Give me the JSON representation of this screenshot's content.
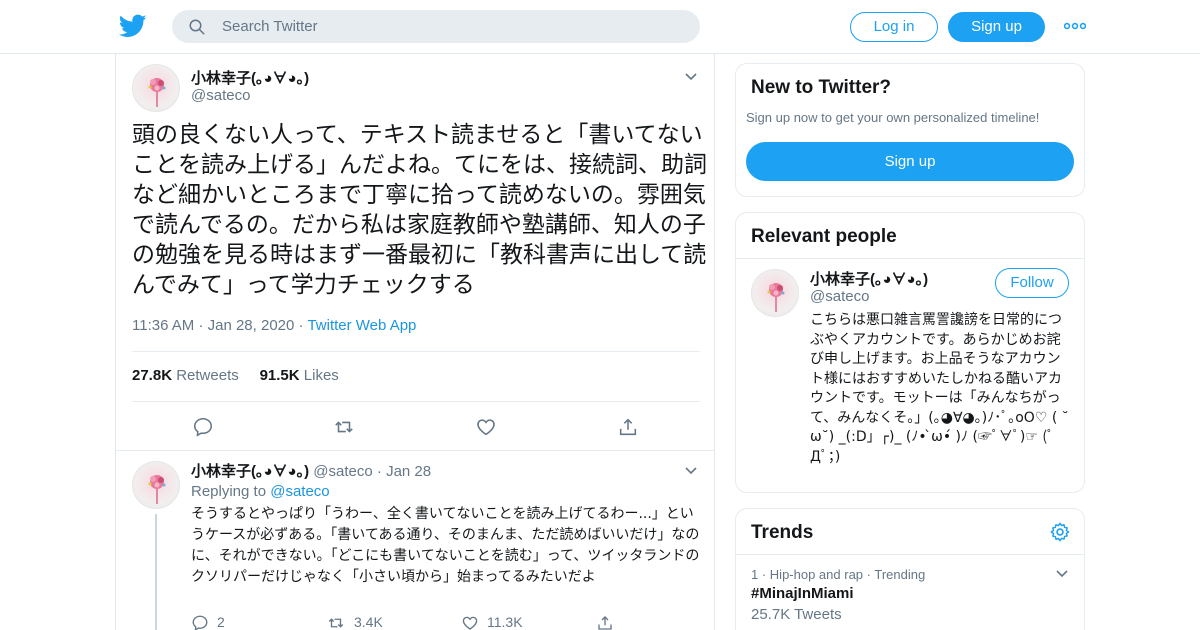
{
  "header": {
    "search_placeholder": "Search Twitter",
    "login_label": "Log in",
    "signup_label": "Sign up"
  },
  "tweet": {
    "author_name": "小林幸子(｡◕∀◕｡)",
    "author_handle": "@sateco",
    "text": "頭の良くない人って、テキスト読ませると「書いてないことを読み上げる」んだよね。てにをは、接続詞、助詞など細かいところまで丁寧に拾って読めないの。雰囲気で読んでるの。だから私は家庭教師や塾講師、知人の子の勉強を見る時はまず一番最初に「教科書声に出して読んでみて」って学力チェックする",
    "time": "11:36 AM",
    "date": "Jan 28, 2020",
    "source": "Twitter Web App",
    "retweets_count": "27.8K",
    "retweets_label": "Retweets",
    "likes_count": "91.5K",
    "likes_label": "Likes"
  },
  "reply": {
    "author_name": "小林幸子(｡◕∀◕｡)",
    "author_handle": "@sateco",
    "date": "Jan 28",
    "replying_label": "Replying to",
    "replying_to": "@sateco",
    "text": "そうするとやっぱり「うわー、全く書いてないことを読み上げてるわー...」というケースが必ずある。「書いてある通り、そのまんま、ただ読めばいいだけ」なのに、それができない。「どこにも書いてないことを読む」って、ツイッタランドのクソリパーだけじゃなく「小さい頃から」始まってるみたいだよ",
    "replies": "2",
    "retweets": "3.4K",
    "likes": "11.3K"
  },
  "sidebar": {
    "new_title": "New to Twitter?",
    "new_subtitle": "Sign up now to get your own personalized timeline!",
    "new_signup": "Sign up",
    "relevant_title": "Relevant people",
    "person_name": "小林幸子(｡◕∀◕｡)",
    "person_handle": "@sateco",
    "follow_label": "Follow",
    "person_bio": "こちらは悪口雑言罵詈讒謗を日常的につぶやくアカウントです。あらかじめお詫び申し上げます。お上品そうなアカウント様にはおすすめいたしかねる酷いアカウントです。モットーは「みんなちがって、みんなくそ。」(｡◕∀◕｡)ﾉ･ﾟ｡oO♡ ( ˘ω˘) _(:D」┌)_ (ﾉ• ̀ω•́ )ﾉ (☞ﾟ∀ﾟ)☞ (ﾟДﾟ；)",
    "trends_title": "Trends",
    "trend_rank": "1",
    "trend_category": "Hip-hop and rap",
    "trend_status": "Trending",
    "trend_name": "#MinajInMiami",
    "trend_count": "25.7K Tweets"
  },
  "colors": {
    "accent": "#1da1f2",
    "link": "#1b95e0",
    "muted": "#657786",
    "border": "#e6ecf0"
  }
}
